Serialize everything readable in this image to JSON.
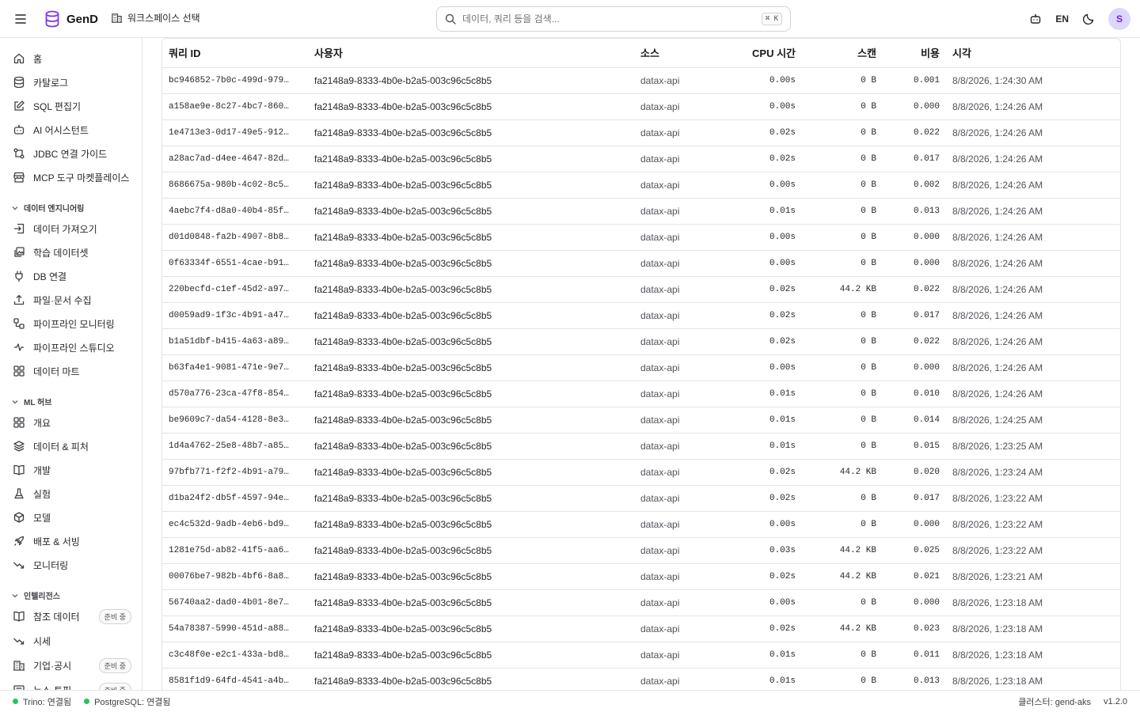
{
  "header": {
    "brand": "GenD",
    "workspace_label": "워크스페이스 선택",
    "search_placeholder": "데이터, 쿼리 등을 검색...",
    "search_shortcut": "⌘ K",
    "lang": "EN",
    "avatar_initial": "S"
  },
  "sidebar": {
    "top_items": [
      {
        "label": "홈",
        "icon": "home-icon"
      },
      {
        "label": "카탈로그",
        "icon": "database-icon"
      },
      {
        "label": "SQL 편집기",
        "icon": "edit-icon"
      },
      {
        "label": "AI 어시스턴트",
        "icon": "bot-icon"
      },
      {
        "label": "JDBC 연결 가이드",
        "icon": "jdbc-icon"
      },
      {
        "label": "MCP 도구 마켓플레이스",
        "icon": "store-icon"
      }
    ],
    "section_data_eng": "데이터 엔지니어링",
    "data_eng_items": [
      {
        "label": "데이터 가져오기",
        "icon": "import-icon"
      },
      {
        "label": "학습 데이터셋",
        "icon": "images-icon"
      },
      {
        "label": "DB 연결",
        "icon": "plug-icon"
      },
      {
        "label": "파일·문서 수집",
        "icon": "upload-icon"
      },
      {
        "label": "파이프라인 모니터링",
        "icon": "pipeline-icon"
      },
      {
        "label": "파이프라인 스튜디오",
        "icon": "studio-icon"
      },
      {
        "label": "데이터 마트",
        "icon": "grid-icon"
      }
    ],
    "section_ml": "ML 허브",
    "ml_items": [
      {
        "label": "개요",
        "icon": "grid-icon"
      },
      {
        "label": "데이터 & 피처",
        "icon": "layers-icon"
      },
      {
        "label": "개발",
        "icon": "book-icon"
      },
      {
        "label": "실험",
        "icon": "flask-icon"
      },
      {
        "label": "모델",
        "icon": "box-icon"
      },
      {
        "label": "배포 & 서빙",
        "icon": "rocket-icon"
      },
      {
        "label": "모니터링",
        "icon": "trend-icon"
      }
    ],
    "section_intel": "인텔리전스",
    "intel_items": [
      {
        "label": "참조 데이터",
        "icon": "book-icon",
        "badge": "준비 중"
      },
      {
        "label": "시세",
        "icon": "trend-icon",
        "badge": ""
      },
      {
        "label": "기업·공시",
        "icon": "building-icon",
        "badge": "준비 중"
      },
      {
        "label": "뉴스·토픽",
        "icon": "news-icon",
        "badge": "준비 중"
      }
    ]
  },
  "table": {
    "columns": [
      "쿼리 ID",
      "사용자",
      "소스",
      "CPU 시간",
      "스캔",
      "비용",
      "시각"
    ],
    "rows": [
      [
        "bc946852-7b0c-499d-979…",
        "fa2148a9-8333-4b0e-b2a5-003c96c5c8b5",
        "datax-api",
        "0.00s",
        "0 B",
        "0.001",
        "8/8/2026, 1:24:30 AM"
      ],
      [
        "a158ae9e-8c27-4bc7-860…",
        "fa2148a9-8333-4b0e-b2a5-003c96c5c8b5",
        "datax-api",
        "0.00s",
        "0 B",
        "0.000",
        "8/8/2026, 1:24:26 AM"
      ],
      [
        "1e4713e3-0d17-49e5-912…",
        "fa2148a9-8333-4b0e-b2a5-003c96c5c8b5",
        "datax-api",
        "0.02s",
        "0 B",
        "0.022",
        "8/8/2026, 1:24:26 AM"
      ],
      [
        "a28ac7ad-d4ee-4647-82d…",
        "fa2148a9-8333-4b0e-b2a5-003c96c5c8b5",
        "datax-api",
        "0.02s",
        "0 B",
        "0.017",
        "8/8/2026, 1:24:26 AM"
      ],
      [
        "8686675a-980b-4c02-8c5…",
        "fa2148a9-8333-4b0e-b2a5-003c96c5c8b5",
        "datax-api",
        "0.00s",
        "0 B",
        "0.002",
        "8/8/2026, 1:24:26 AM"
      ],
      [
        "4aebc7f4-d8a0-40b4-85f…",
        "fa2148a9-8333-4b0e-b2a5-003c96c5c8b5",
        "datax-api",
        "0.01s",
        "0 B",
        "0.013",
        "8/8/2026, 1:24:26 AM"
      ],
      [
        "d01d0848-fa2b-4907-8b8…",
        "fa2148a9-8333-4b0e-b2a5-003c96c5c8b5",
        "datax-api",
        "0.00s",
        "0 B",
        "0.000",
        "8/8/2026, 1:24:26 AM"
      ],
      [
        "0f63334f-6551-4cae-b91…",
        "fa2148a9-8333-4b0e-b2a5-003c96c5c8b5",
        "datax-api",
        "0.00s",
        "0 B",
        "0.000",
        "8/8/2026, 1:24:26 AM"
      ],
      [
        "220becfd-c1ef-45d2-a97…",
        "fa2148a9-8333-4b0e-b2a5-003c96c5c8b5",
        "datax-api",
        "0.02s",
        "44.2 KB",
        "0.022",
        "8/8/2026, 1:24:26 AM"
      ],
      [
        "d0059ad9-1f3c-4b91-a47…",
        "fa2148a9-8333-4b0e-b2a5-003c96c5c8b5",
        "datax-api",
        "0.02s",
        "0 B",
        "0.017",
        "8/8/2026, 1:24:26 AM"
      ],
      [
        "b1a51dbf-b415-4a63-a89…",
        "fa2148a9-8333-4b0e-b2a5-003c96c5c8b5",
        "datax-api",
        "0.02s",
        "0 B",
        "0.022",
        "8/8/2026, 1:24:26 AM"
      ],
      [
        "b63fa4e1-9081-471e-9e7…",
        "fa2148a9-8333-4b0e-b2a5-003c96c5c8b5",
        "datax-api",
        "0.00s",
        "0 B",
        "0.000",
        "8/8/2026, 1:24:26 AM"
      ],
      [
        "d570a776-23ca-47f8-854…",
        "fa2148a9-8333-4b0e-b2a5-003c96c5c8b5",
        "datax-api",
        "0.01s",
        "0 B",
        "0.010",
        "8/8/2026, 1:24:26 AM"
      ],
      [
        "be9609c7-da54-4128-8e3…",
        "fa2148a9-8333-4b0e-b2a5-003c96c5c8b5",
        "datax-api",
        "0.01s",
        "0 B",
        "0.014",
        "8/8/2026, 1:24:25 AM"
      ],
      [
        "1d4a4762-25e8-48b7-a85…",
        "fa2148a9-8333-4b0e-b2a5-003c96c5c8b5",
        "datax-api",
        "0.01s",
        "0 B",
        "0.015",
        "8/8/2026, 1:23:25 AM"
      ],
      [
        "97bfb771-f2f2-4b91-a79…",
        "fa2148a9-8333-4b0e-b2a5-003c96c5c8b5",
        "datax-api",
        "0.02s",
        "44.2 KB",
        "0.020",
        "8/8/2026, 1:23:24 AM"
      ],
      [
        "d1ba24f2-db5f-4597-94e…",
        "fa2148a9-8333-4b0e-b2a5-003c96c5c8b5",
        "datax-api",
        "0.02s",
        "0 B",
        "0.017",
        "8/8/2026, 1:23:22 AM"
      ],
      [
        "ec4c532d-9adb-4eb6-bd9…",
        "fa2148a9-8333-4b0e-b2a5-003c96c5c8b5",
        "datax-api",
        "0.00s",
        "0 B",
        "0.000",
        "8/8/2026, 1:23:22 AM"
      ],
      [
        "1281e75d-ab82-41f5-aa6…",
        "fa2148a9-8333-4b0e-b2a5-003c96c5c8b5",
        "datax-api",
        "0.03s",
        "44.2 KB",
        "0.025",
        "8/8/2026, 1:23:22 AM"
      ],
      [
        "00076be7-982b-4bf6-8a8…",
        "fa2148a9-8333-4b0e-b2a5-003c96c5c8b5",
        "datax-api",
        "0.02s",
        "44.2 KB",
        "0.021",
        "8/8/2026, 1:23:21 AM"
      ],
      [
        "56740aa2-dad0-4b01-8e7…",
        "fa2148a9-8333-4b0e-b2a5-003c96c5c8b5",
        "datax-api",
        "0.00s",
        "0 B",
        "0.000",
        "8/8/2026, 1:23:18 AM"
      ],
      [
        "54a78387-5990-451d-a88…",
        "fa2148a9-8333-4b0e-b2a5-003c96c5c8b5",
        "datax-api",
        "0.02s",
        "44.2 KB",
        "0.023",
        "8/8/2026, 1:23:18 AM"
      ],
      [
        "c3c48f0e-e2c1-433a-bd8…",
        "fa2148a9-8333-4b0e-b2a5-003c96c5c8b5",
        "datax-api",
        "0.01s",
        "0 B",
        "0.011",
        "8/8/2026, 1:23:18 AM"
      ],
      [
        "8581f1d9-64fd-4541-a4b…",
        "fa2148a9-8333-4b0e-b2a5-003c96c5c8b5",
        "datax-api",
        "0.01s",
        "0 B",
        "0.013",
        "8/8/2026, 1:23:18 AM"
      ]
    ]
  },
  "status": {
    "trino": "Trino: 연결됨",
    "postgres": "PostgreSQL: 연결됨",
    "cluster": "클러스터: gend-aks",
    "version": "v1.2.0",
    "ok_color": "#22c55e"
  }
}
